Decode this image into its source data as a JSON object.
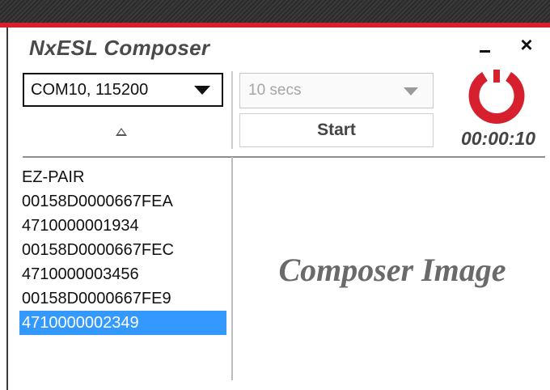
{
  "app": {
    "title": "NxESL Composer",
    "window_controls": {
      "minimize_icon": "minimize-icon",
      "close_icon": "close-icon",
      "close_label": "×"
    }
  },
  "connection": {
    "port_value": "COM10, 115200"
  },
  "interval": {
    "value": "10 secs"
  },
  "start_button": {
    "label": "Start"
  },
  "timer": {
    "value": "00:00:10",
    "icon": "power-timer-icon",
    "accent_color": "#d6202e"
  },
  "device_list": {
    "sort_icon": "sort-ascending-icon",
    "items": [
      {
        "label": "EZ-PAIR",
        "selected": false
      },
      {
        "label": "00158D0000667FEA",
        "selected": false
      },
      {
        "label": "4710000001934",
        "selected": false
      },
      {
        "label": "00158D0000667FEC",
        "selected": false
      },
      {
        "label": "4710000003456",
        "selected": false
      },
      {
        "label": "00158D0000667FE9",
        "selected": false
      },
      {
        "label": "4710000002349",
        "selected": true
      }
    ]
  },
  "preview": {
    "label": "Composer Image"
  },
  "colors": {
    "brand_red": "#d6202e",
    "selection_blue": "#3399ff"
  }
}
